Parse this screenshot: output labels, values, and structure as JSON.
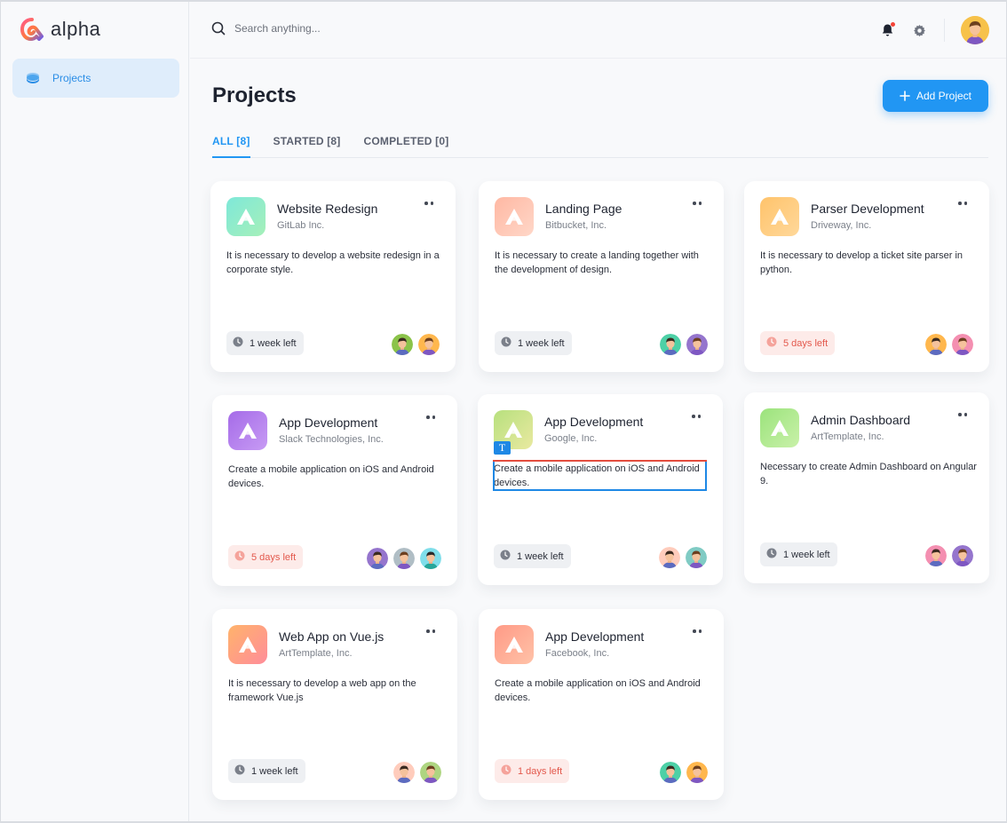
{
  "app": {
    "name": "alpha"
  },
  "sidebar": {
    "items": [
      {
        "label": "Projects",
        "icon": "layers-icon",
        "active": true
      }
    ]
  },
  "search": {
    "placeholder": "Search anything..."
  },
  "header": {
    "title": "Projects",
    "add_button_label": "Add Project"
  },
  "tabs": [
    {
      "label": "ALL [8]",
      "active": true
    },
    {
      "label": "STARTED [8]",
      "active": false
    },
    {
      "label": "COMPLETED [0]",
      "active": false
    }
  ],
  "colors": {
    "accent": "#2196f3",
    "urgent": "#e3584c",
    "urgent_bg": "#fdebe9",
    "neutral_bg": "#eef0f3"
  },
  "projects": [
    {
      "title": "Website Redesign",
      "company": "GitLab Inc.",
      "description": "It is necessary to develop a website redesign in a corporate style.",
      "deadline": "1 week left",
      "urgent": false,
      "logo_gradient": [
        "#7ee8d9",
        "#a6f0b9"
      ],
      "avatars": [
        "#8bc34a",
        "#ffb74d"
      ]
    },
    {
      "title": "Landing Page",
      "company": "Bitbucket, Inc.",
      "description": "It is necessary to create a landing together with the development of design.",
      "deadline": "1 week left",
      "urgent": false,
      "logo_gradient": [
        "#ffb8a3",
        "#ffd7c8"
      ],
      "avatars": [
        "#4dd0a6",
        "#9575cd"
      ]
    },
    {
      "title": "Parser Development",
      "company": "Driveway, Inc.",
      "description": "It is necessary to develop a ticket site parser in python.",
      "deadline": "5 days left",
      "urgent": true,
      "logo_gradient": [
        "#ffc36b",
        "#ffd89a"
      ],
      "avatars": [
        "#ffb74d",
        "#f48fb1"
      ]
    },
    {
      "title": "App Development",
      "company": "Slack Technologies, Inc.",
      "description": "Create a mobile application on iOS and Android devices.",
      "deadline": "5 days left",
      "urgent": true,
      "logo_gradient": [
        "#a56be8",
        "#c79bf4"
      ],
      "avatars": [
        "#9575cd",
        "#b0bec5",
        "#80deea"
      ]
    },
    {
      "title": "App Development",
      "company": "Google, Inc.",
      "description": "Create a mobile application on iOS and Android devices.",
      "deadline": "1 week left",
      "urgent": false,
      "logo_gradient": [
        "#b7e07e",
        "#e9e9a0"
      ],
      "avatars": [
        "#ffccbc",
        "#80cbc4"
      ]
    },
    {
      "title": "Admin Dashboard",
      "company": "ArtTemplate, Inc.",
      "description": "Necessary to create Admin Dashboard on Angular 9.",
      "deadline": "1 week left",
      "urgent": false,
      "logo_gradient": [
        "#9be37c",
        "#c9f1a9"
      ],
      "avatars": [
        "#f48fb1",
        "#9575cd"
      ]
    },
    {
      "title": "Web App on Vue.js",
      "company": "ArtTemplate, Inc.",
      "description": "It is necessary to develop a web app on the framework Vue.js",
      "deadline": "1 week left",
      "urgent": false,
      "logo_gradient": [
        "#ffb36b",
        "#ff8d9a"
      ],
      "avatars": [
        "#ffccbc",
        "#aed581"
      ]
    },
    {
      "title": "App Development",
      "company": "Facebook, Inc.",
      "description": "Create a mobile application on iOS and Android devices.",
      "deadline": "1 days left",
      "urgent": true,
      "logo_gradient": [
        "#ff9a86",
        "#ffc2a8"
      ],
      "avatars": [
        "#4dd0a6",
        "#ffb74d"
      ]
    }
  ]
}
